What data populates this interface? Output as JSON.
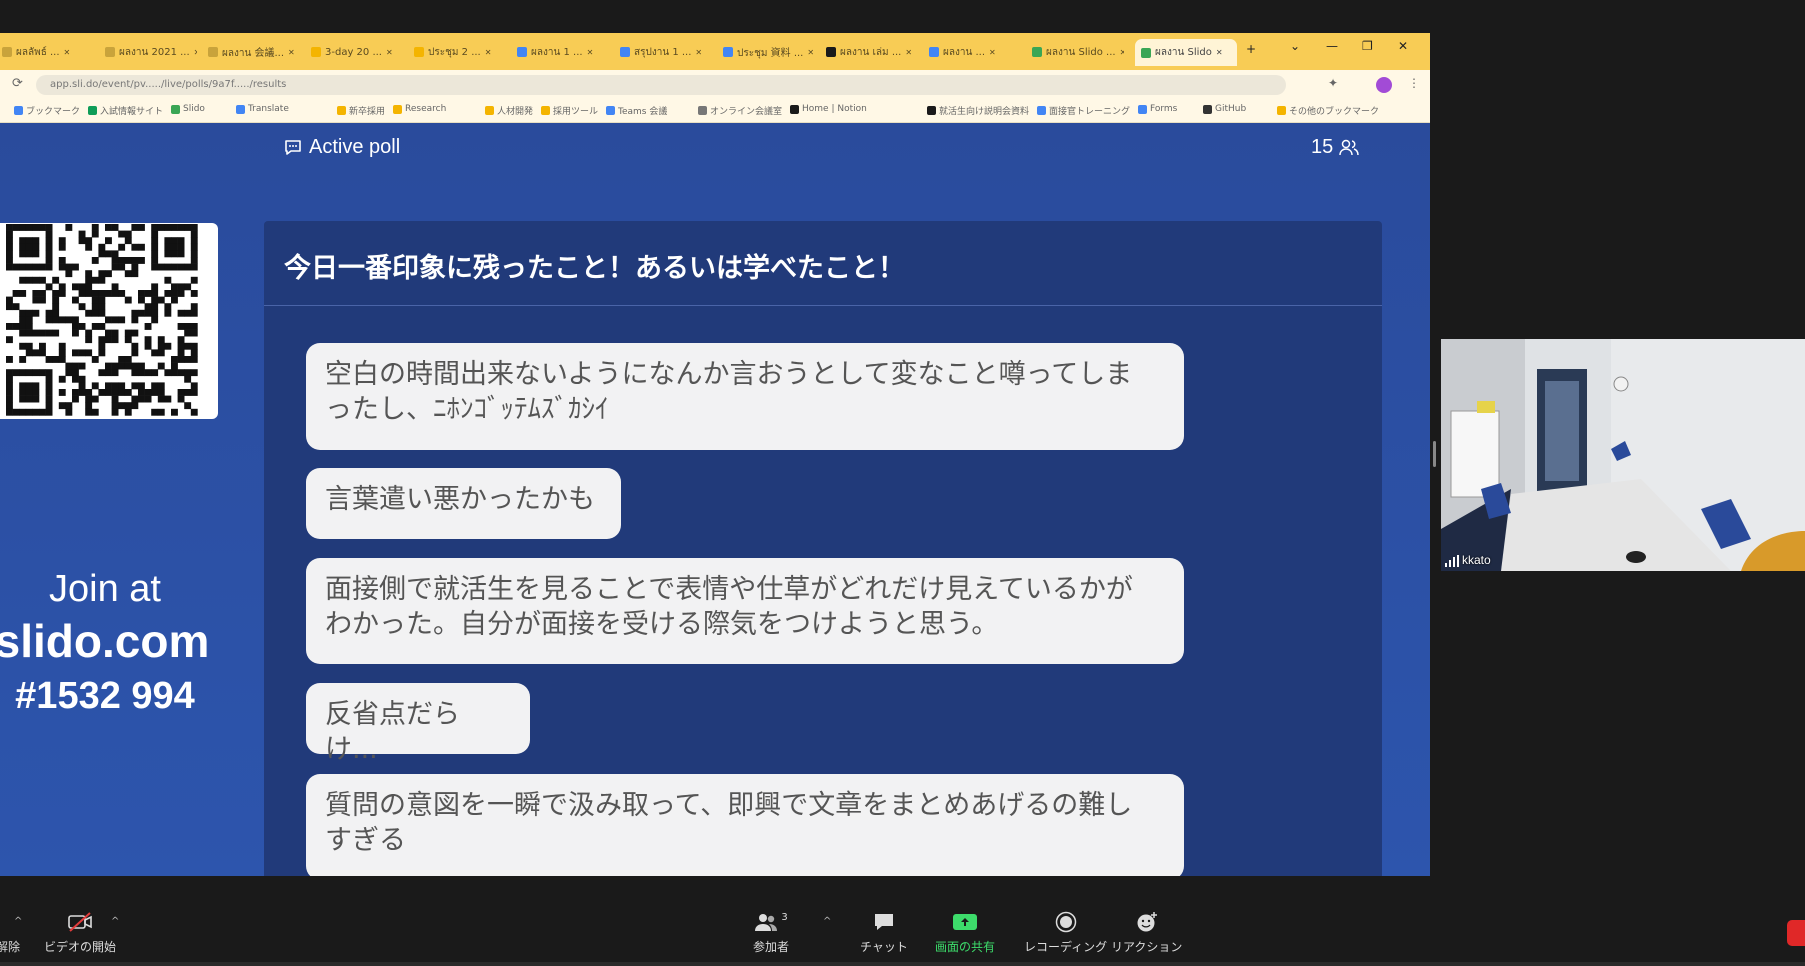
{
  "browser": {
    "tabs": [
      {
        "label": "ผลลัพธ์ ...",
        "color": "#c9a33b"
      },
      {
        "label": "ผลงาน 2021 ...",
        "color": "#c9a33b"
      },
      {
        "label": "ผลงาน 会議...",
        "color": "#c9a33b"
      },
      {
        "label": "3-day 20 ...",
        "color": "#f4b400"
      },
      {
        "label": "ประชุม 2 ...",
        "color": "#f4b400"
      },
      {
        "label": "ผลงาน 1 ...",
        "color": "#4285f4"
      },
      {
        "label": "สรุปงาน 1 ...",
        "color": "#4285f4"
      },
      {
        "label": "ประชุม 資料 ...",
        "color": "#4285f4"
      },
      {
        "label": "ผลงาน เล่ม ...",
        "color": "#1a1a1a"
      },
      {
        "label": "ผลงาน ...",
        "color": "#4285f4"
      },
      {
        "label": "ผลงาน Slido ...",
        "color": "#3aa655"
      },
      {
        "label": "ผลงาน Slido",
        "color": "#3aa655",
        "active": true
      }
    ],
    "window_controls": [
      "⌄",
      "—",
      "❐",
      "✕"
    ],
    "url": "app.sli.do/event/pv...../live/polls/9a7f...../results",
    "bookmarks": [
      {
        "label": "ブックマーク",
        "color": "#4285f4"
      },
      {
        "label": "入試情報サイト",
        "color": "#0f9d58"
      },
      {
        "label": "Slido",
        "color": "#3aa655"
      },
      {
        "label": "Translate",
        "color": "#4285f4"
      },
      {
        "label": "新卒採用",
        "color": "#f4b400"
      },
      {
        "label": "Research",
        "color": "#f4b400"
      },
      {
        "label": "人材開発",
        "color": "#f4b400"
      },
      {
        "label": "採用ツール",
        "color": "#f4b400"
      },
      {
        "label": "Teams 会議",
        "color": "#4285f4"
      },
      {
        "label": "オンライン会議室",
        "color": "#777"
      },
      {
        "label": "Home | Notion",
        "color": "#1a1a1a"
      },
      {
        "label": "就活生向け説明会資料",
        "color": "#1a1a1a"
      },
      {
        "label": "面接官トレーニング",
        "color": "#4285f4"
      },
      {
        "label": "Forms",
        "color": "#4285f4"
      },
      {
        "label": "GitHub",
        "color": "#333"
      },
      {
        "label": "その他のブックマーク",
        "color": "#f4b400"
      }
    ]
  },
  "poll": {
    "header_label": "Active poll",
    "participants": "15",
    "question": "今日一番印象に残ったこと！あるいは学べたこと！",
    "answers": [
      {
        "line1": "空白の時間出来ないようになんか言おうとして変なこと噂ってしま",
        "line2": "ったし、ﾆﾎﾝｺﾞｯﾃﾑｽﾞｶｼｲ"
      },
      {
        "line1": "言葉遣い悪かったかも",
        "line2": ""
      },
      {
        "line1": "面接側で就活生を見ることで表情や仕草がどれだけ見えているかが",
        "line2": "わかった。自分が面接を受ける際気をつけようと思う。"
      },
      {
        "line1": "反省点だらけ...",
        "line2": ""
      },
      {
        "line1": "質問の意図を一瞬で汲み取って、即興で文章をまとめあげるの難し",
        "line2": "すぎる"
      }
    ],
    "join": {
      "line1": "Join at",
      "line2": "slido.com",
      "line3": "#1532 994"
    }
  },
  "video": {
    "name": "kkato"
  },
  "toolbar": {
    "mute_partial": "解除",
    "video_start": "ビデオの開始",
    "participants_label": "参加者",
    "participants_count": "3",
    "chat": "チャット",
    "share_screen": "画面の共有",
    "recording": "レコーディング",
    "reactions": "リアクション",
    "share_color": "#3ddc6b"
  }
}
